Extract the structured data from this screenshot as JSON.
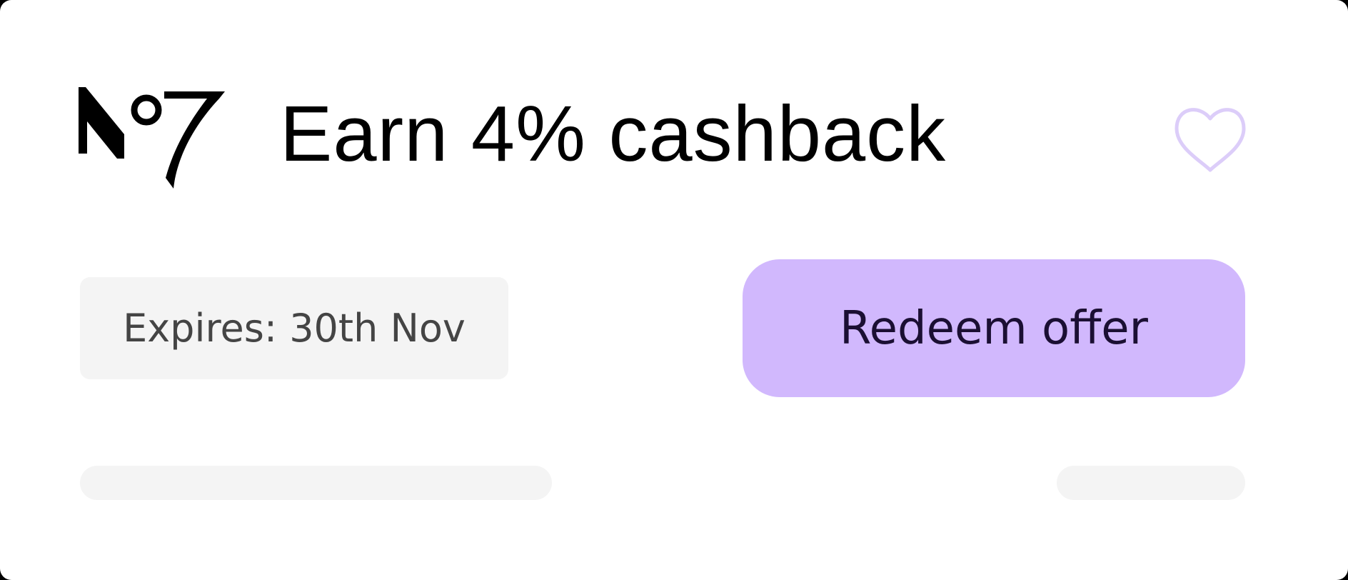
{
  "brand": {
    "logo_text": "N°7",
    "logo_icon": "no7-logo"
  },
  "offer": {
    "title": "Earn 4% cashback",
    "expiry_label": "Expires: 30th Nov",
    "redeem_label": "Redeem offer",
    "favorite_icon": "heart-outline-icon"
  },
  "colors": {
    "accent": "#d1b8fd",
    "accent_text": "#1b0f33",
    "heart_stroke": "#dccdf9",
    "chip_background": "#f4f4f4",
    "title_text": "#000000"
  }
}
